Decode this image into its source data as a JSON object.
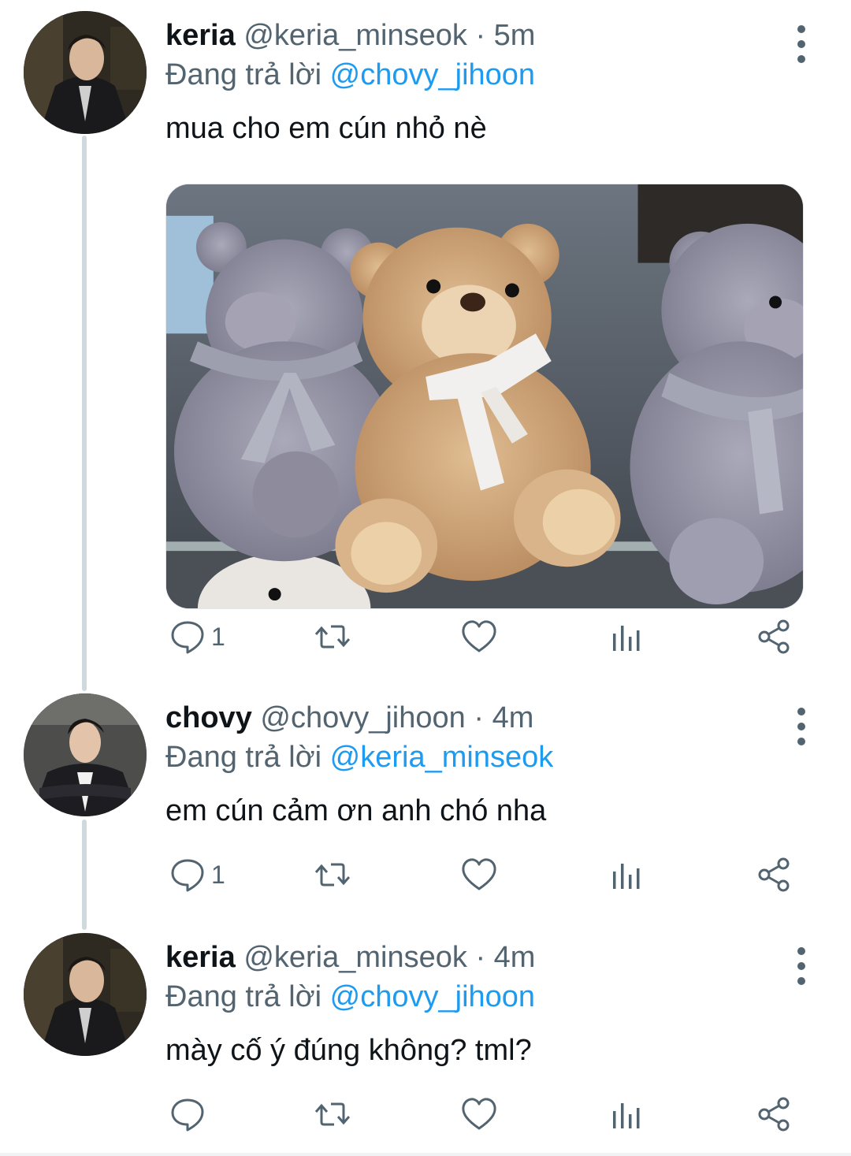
{
  "tweets": [
    {
      "name": "keria",
      "handle": "@keria_minseok",
      "dot": "·",
      "time": "5m",
      "replying_label": "Đang trả lời",
      "replying_to": "@chovy_jihoon",
      "text": "mua cho em cún nhỏ nè",
      "has_media": true,
      "media_subject": "teddy-bears-photo",
      "reply_count": "1"
    },
    {
      "name": "chovy",
      "handle": "@chovy_jihoon",
      "dot": "·",
      "time": "4m",
      "replying_label": "Đang trả lời",
      "replying_to": "@keria_minseok",
      "text": "em cún cảm ơn anh chó nha",
      "has_media": false,
      "reply_count": "1"
    },
    {
      "name": "keria",
      "handle": "@keria_minseok",
      "dot": "·",
      "time": "4m",
      "replying_label": "Đang trả lời",
      "replying_to": "@chovy_jihoon",
      "text": "mày cố ý đúng không? tml?",
      "has_media": false,
      "reply_count": ""
    }
  ],
  "icons": {
    "reply": "reply-icon",
    "retweet": "retweet-icon",
    "like": "like-icon",
    "views": "analytics-icon",
    "share": "share-icon",
    "more": "more-vertical-icon"
  },
  "colors": {
    "text": "#0f1419",
    "secondary": "#536471",
    "link": "#1d9bf0",
    "thread_line": "#cfd9de"
  }
}
